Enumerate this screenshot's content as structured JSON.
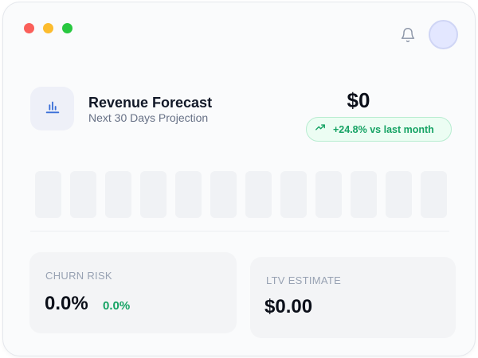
{
  "window": {
    "traffic_lights": [
      "#fa5f5a",
      "#fcbc2e",
      "#28c840"
    ]
  },
  "header": {
    "bell_icon": "bell-icon",
    "avatar_color": "#e3e7ff"
  },
  "forecast": {
    "icon": "bar-chart-icon",
    "title": "Revenue Forecast",
    "subtitle": "Next 30 Days Projection",
    "amount": "$0",
    "trend_icon": "trending-up-icon",
    "trend_text": "+24.8% vs last month",
    "accent": "#16a364"
  },
  "bars_count_placeholder": 12,
  "churn": {
    "label": "CHURN RISK",
    "value": "0.0%",
    "delta": "0.0%"
  },
  "ltv": {
    "label": "LTV ESTIMATE",
    "value": "$0.00"
  }
}
